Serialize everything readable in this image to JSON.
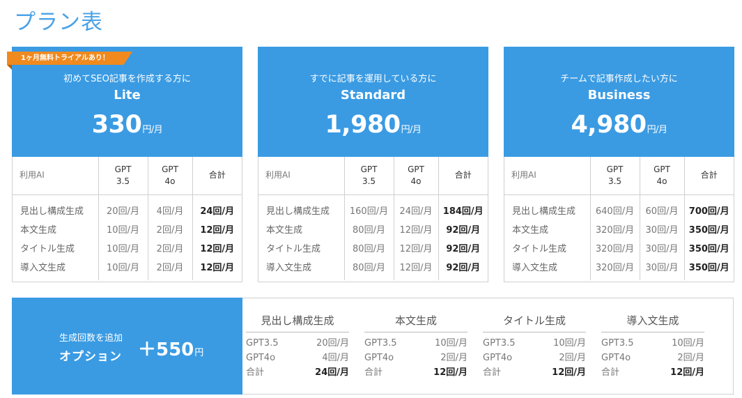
{
  "page_title": "プラン表",
  "badge": "1ヶ月無料トライアルあり！",
  "table_headers": {
    "ai": "利用AI",
    "gpt35": [
      "GPT",
      "3.5"
    ],
    "gpt4o": [
      "GPT",
      "4o"
    ],
    "total": "合計"
  },
  "plans": [
    {
      "tagline": "初めてSEO記事を作成する方に",
      "name": "Lite",
      "price": "330",
      "unit": "円/月",
      "rows": [
        {
          "label": "見出し構成生成",
          "gpt35": "20回/月",
          "gpt4o": "4回/月",
          "total": "24回/月"
        },
        {
          "label": "本文生成",
          "gpt35": "10回/月",
          "gpt4o": "2回/月",
          "total": "12回/月"
        },
        {
          "label": "タイトル生成",
          "gpt35": "10回/月",
          "gpt4o": "2回/月",
          "total": "12回/月"
        },
        {
          "label": "導入文生成",
          "gpt35": "10回/月",
          "gpt4o": "2回/月",
          "total": "12回/月"
        }
      ]
    },
    {
      "tagline": "すでに記事を運用している方に",
      "name": "Standard",
      "price": "1,980",
      "unit": "円/月",
      "rows": [
        {
          "label": "見出し構成生成",
          "gpt35": "160回/月",
          "gpt4o": "24回/月",
          "total": "184回/月"
        },
        {
          "label": "本文生成",
          "gpt35": "80回/月",
          "gpt4o": "12回/月",
          "total": "92回/月"
        },
        {
          "label": "タイトル生成",
          "gpt35": "80回/月",
          "gpt4o": "12回/月",
          "total": "92回/月"
        },
        {
          "label": "導入文生成",
          "gpt35": "80回/月",
          "gpt4o": "12回/月",
          "total": "92回/月"
        }
      ]
    },
    {
      "tagline": "チームで記事作成したい方に",
      "name": "Business",
      "price": "4,980",
      "unit": "円/月",
      "rows": [
        {
          "label": "見出し構成生成",
          "gpt35": "640回/月",
          "gpt4o": "60回/月",
          "total": "700回/月"
        },
        {
          "label": "本文生成",
          "gpt35": "320回/月",
          "gpt4o": "30回/月",
          "total": "350回/月"
        },
        {
          "label": "タイトル生成",
          "gpt35": "320回/月",
          "gpt4o": "30回/月",
          "total": "350回/月"
        },
        {
          "label": "導入文生成",
          "gpt35": "320回/月",
          "gpt4o": "30回/月",
          "total": "350回/月"
        }
      ]
    }
  ],
  "option": {
    "subtitle": "生成回数を追加",
    "name": "オプション",
    "price": "＋550",
    "unit": "円",
    "row_labels": {
      "gpt35": "GPT3.5",
      "gpt4o": "GPT4o",
      "total": "合計"
    },
    "columns": [
      {
        "title": "見出し構成生成",
        "gpt35": "20回/月",
        "gpt4o": "4回/月",
        "total": "24回/月"
      },
      {
        "title": "本文生成",
        "gpt35": "10回/月",
        "gpt4o": "2回/月",
        "total": "12回/月"
      },
      {
        "title": "タイトル生成",
        "gpt35": "10回/月",
        "gpt4o": "2回/月",
        "total": "12回/月"
      },
      {
        "title": "導入文生成",
        "gpt35": "10回/月",
        "gpt4o": "2回/月",
        "total": "12回/月"
      }
    ]
  },
  "colors": {
    "brand_blue": "#3a9be3",
    "title_blue": "#4aa3e6",
    "badge_orange": "#f08a1f"
  }
}
